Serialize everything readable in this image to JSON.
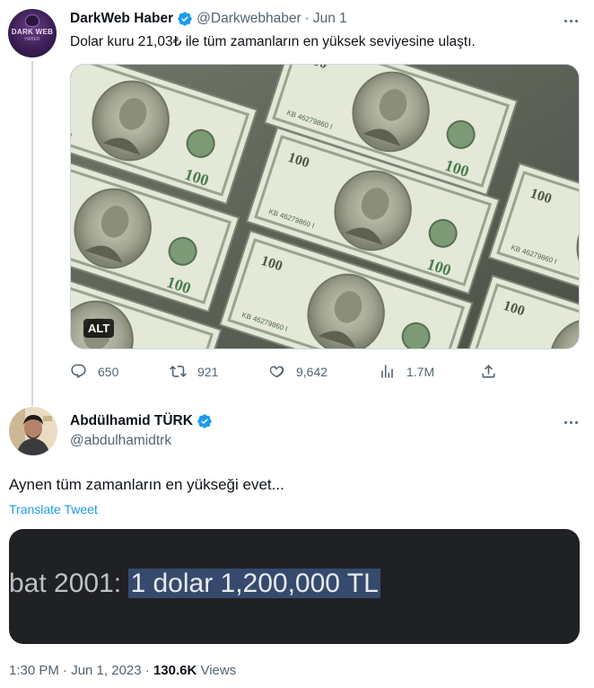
{
  "tweet": {
    "author_name": "DarkWeb Haber",
    "handle": "@Darkwebhaber",
    "separator": "·",
    "date": "Jun 1",
    "text": "Dolar kuru 21,03₺ ile tüm zamanların en yüksek seviyesine ulaştı.",
    "avatar_text": "DARK WEB",
    "avatar_subtext": "HABER",
    "media_alt_label": "ALT",
    "stats": {
      "replies": "650",
      "retweets": "921",
      "likes": "9,642",
      "views": "1.7M"
    }
  },
  "reply": {
    "author_name": "Abdülhamid TÜRK",
    "handle": "@abdulhamidtrk",
    "text": "Aynen tüm zamanların en yükseği evet...",
    "translate_label": "Translate Tweet",
    "image_text_prefix": "bat 2001: ",
    "image_text_highlight": "1 dolar 1,200,000 TL",
    "timestamp": "1:30 PM · Jun 1, 2023",
    "separator": " · ",
    "views_count": "130.6K",
    "views_label": " Views"
  },
  "colors": {
    "verified_blue": "#1d9bf0",
    "text_primary": "#0f1419",
    "text_secondary": "#536471",
    "link": "#1d9bf0",
    "highlight": "#364a6e"
  },
  "icons": [
    "verified-badge-icon",
    "more-icon",
    "reply-icon",
    "retweet-icon",
    "like-icon",
    "views-icon",
    "share-icon"
  ]
}
